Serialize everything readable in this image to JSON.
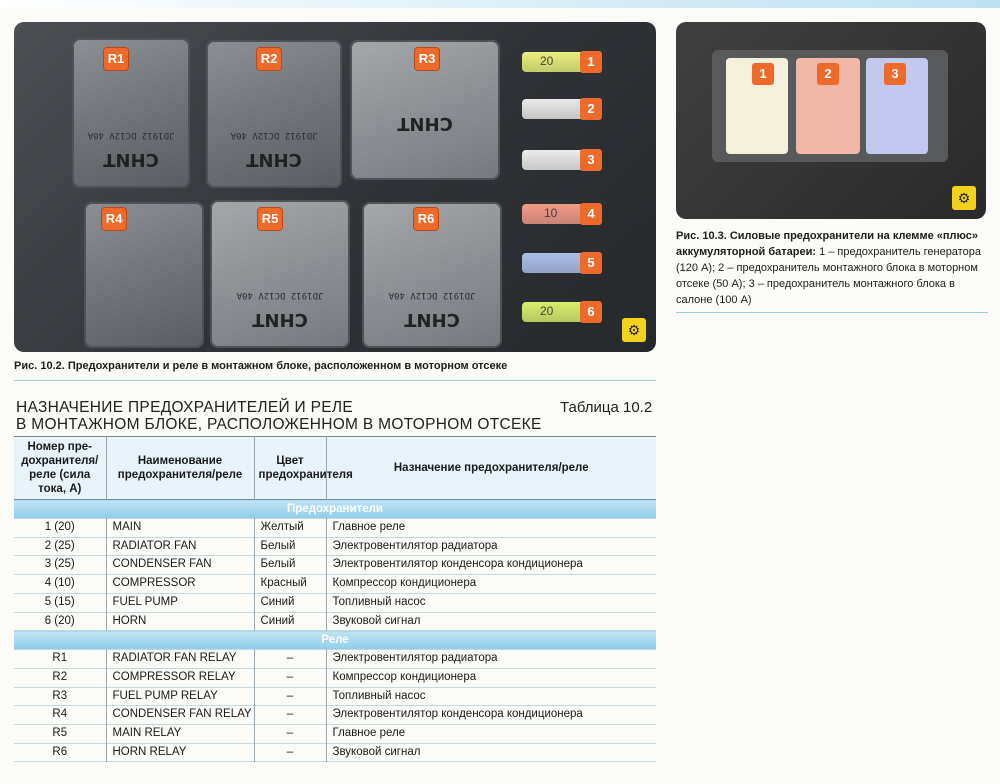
{
  "figure1": {
    "relays": [
      {
        "label": "R1",
        "brand": "CHNT",
        "spec": "JD1912 DC12V 40A"
      },
      {
        "label": "R2",
        "brand": "CHNT",
        "spec": "JD1912 DC12V 40A"
      },
      {
        "label": "R3",
        "brand": "CHNT",
        "spec": ""
      },
      {
        "label": "R4",
        "brand": "",
        "spec": ""
      },
      {
        "label": "R5",
        "brand": "CHNT",
        "spec": "JD1912 DC12V 40A"
      },
      {
        "label": "R6",
        "brand": "CHNT",
        "spec": "JD1912 DC12V 40A"
      }
    ],
    "fuses": [
      {
        "number": "1",
        "text": "20",
        "color": "#e8f07a"
      },
      {
        "number": "2",
        "text": "",
        "color": "#e9e9e9"
      },
      {
        "number": "3",
        "text": "",
        "color": "#ececec"
      },
      {
        "number": "4",
        "text": "10",
        "color": "#f29a86"
      },
      {
        "number": "5",
        "text": "",
        "color": "#aebfe8"
      },
      {
        "number": "6",
        "text": "20",
        "color": "#d8ee6a"
      }
    ],
    "caption": "Рис. 10.2. Предохранители и реле в монтажном блоке, расположенном в моторном отсеке"
  },
  "figure2": {
    "fuses": [
      {
        "number": "1",
        "color": "#f4f0dc"
      },
      {
        "number": "2",
        "color": "#f1b8aa"
      },
      {
        "number": "3",
        "color": "#c2c8ee"
      }
    ],
    "caption_bold": "Рис. 10.3. Силовые предохранители на клемме «плюс» аккумуляторной батареи:",
    "caption_text": " 1 – предохранитель генератора (120 А); 2 – предохранитель монтажного блока в моторном отсеке (50 А); 3 – предохранитель монтажного блока в салоне (100 А)"
  },
  "table": {
    "title_line1": "НАЗНАЧЕНИЕ ПРЕДОХРАНИТЕЛЕЙ И РЕЛЕ",
    "title_line2": "В МОНТАЖНОМ БЛОКЕ, РАСПОЛОЖЕННОМ В МОТОРНОМ ОТСЕКЕ",
    "number": "Таблица 10.2",
    "headers": [
      "Номер пре-дохранителя/реле (сила тока, А)",
      "Наименование предохранителя/реле",
      "Цвет предохранителя",
      "Назначение предохранителя/реле"
    ],
    "section_fuses": "Предохранители",
    "fuse_rows": [
      [
        "1 (20)",
        "MAIN",
        "Желтый",
        "Главное реле"
      ],
      [
        "2 (25)",
        "RADIATOR FAN",
        "Белый",
        "Электровентилятор радиатора"
      ],
      [
        "3 (25)",
        "CONDENSER FAN",
        "Белый",
        "Электровентилятор конденсора кондиционера"
      ],
      [
        "4 (10)",
        "COMPRESSOR",
        "Красный",
        "Компрессор кондиционера"
      ],
      [
        "5 (15)",
        "FUEL PUMP",
        "Синий",
        "Топливный насос"
      ],
      [
        "6 (20)",
        "HORN",
        "Синий",
        "Звуковой сигнал"
      ]
    ],
    "section_relays": "Реле",
    "relay_rows": [
      [
        "R1",
        "RADIATOR FAN RELAY",
        "–",
        "Электровентилятор радиатора"
      ],
      [
        "R2",
        "COMPRESSOR RELAY",
        "–",
        "Компрессор кондиционера"
      ],
      [
        "R3",
        "FUEL PUMP RELAY",
        "–",
        "Топливный насос"
      ],
      [
        "R4",
        "CONDENSER FAN RELAY",
        "–",
        "Электровентилятор конденсора кондиционера"
      ],
      [
        "R5",
        "MAIN RELAY",
        "–",
        "Главное реле"
      ],
      [
        "R6",
        "HORN RELAY",
        "–",
        "Звуковой сигнал"
      ]
    ]
  }
}
